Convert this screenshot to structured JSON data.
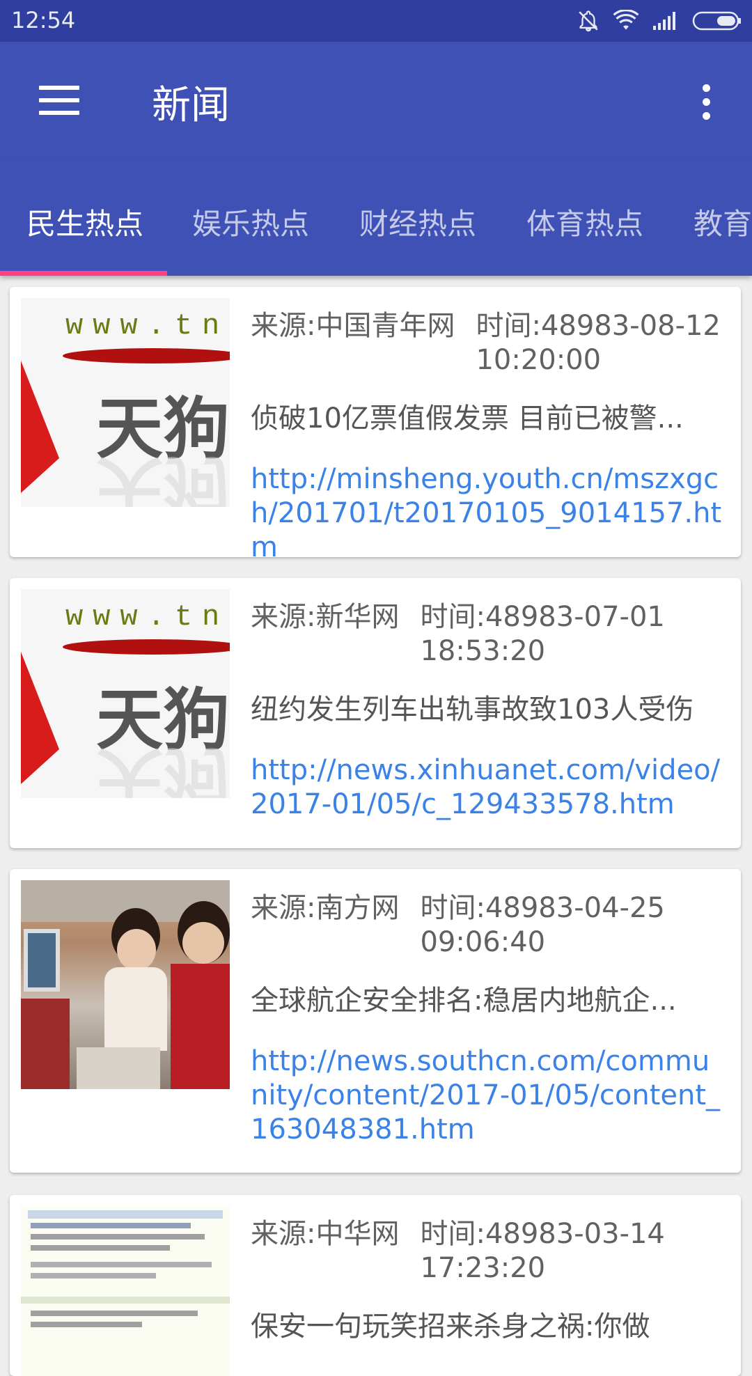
{
  "status": {
    "time": "12:54"
  },
  "app": {
    "title": "新闻"
  },
  "tabs": [
    "民生热点",
    "娱乐热点",
    "财经热点",
    "体育热点",
    "教育"
  ],
  "colors": {
    "primary": "#3f51b5",
    "primary_dark": "#303f9f",
    "accent": "#ff4081",
    "link": "#3b82e8"
  },
  "news": [
    {
      "source": "来源:中国青年网",
      "time": "时间:48983-08-12 10:20:00",
      "headline": "侦破10亿票值假发票 目前已被警...",
      "url": "http://minsheng.youth.cn/mszxgch/201701/t20170105_9014157.htm",
      "thumb_text_top": "www.tn",
      "thumb_text_main": "天狗"
    },
    {
      "source": "来源:新华网",
      "time": "时间:48983-07-01 18:53:20",
      "headline": "纽约发生列车出轨事故致103人受伤",
      "url": "http://news.xinhuanet.com/video/2017-01/05/c_129433578.htm",
      "thumb_text_top": "www.tn",
      "thumb_text_main": "天狗"
    },
    {
      "source": "来源:南方网",
      "time": "时间:48983-04-25 09:06:40",
      "headline": "全球航企安全排名:稳居内地航企...",
      "url": "http://news.southcn.com/community/content/2017-01/05/content_163048381.htm"
    },
    {
      "source": "来源:中华网",
      "time": "时间:48983-03-14 17:23:20",
      "headline": "保安一句玩笑招来杀身之祸:你做"
    }
  ]
}
